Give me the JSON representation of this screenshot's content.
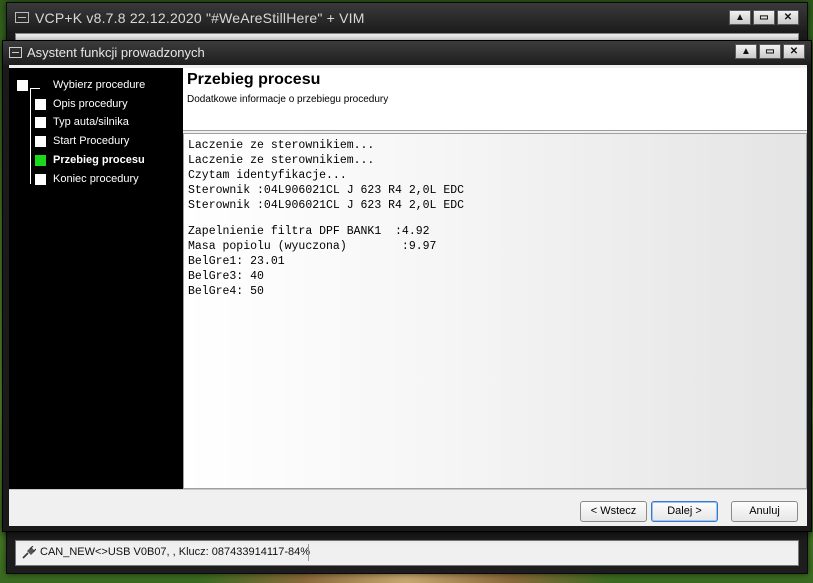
{
  "main_window": {
    "title": "VCP+K v8.7.8 22.12.2020 \"#WeAreStillHere\" + VIM",
    "controls": [
      "▲",
      "▭",
      "✕"
    ]
  },
  "dialog": {
    "title": "Asystent funkcji prowadzonych",
    "controls": [
      "▲",
      "▭",
      "✕"
    ]
  },
  "steps": [
    {
      "label": "Wybierz procedure",
      "active": false
    },
    {
      "label": "Opis procedury",
      "active": false
    },
    {
      "label": "Typ auta/silnika",
      "active": false
    },
    {
      "label": "Start Procedury",
      "active": false
    },
    {
      "label": "Przebieg procesu",
      "active": true
    },
    {
      "label": "Koniec procedury",
      "active": false
    }
  ],
  "header": {
    "title": "Przebieg procesu",
    "subtitle": "Dodatkowe informacje o przebiegu procedury"
  },
  "log_lines": [
    "Laczenie ze sterownikiem...",
    "Laczenie ze sterownikiem...",
    "Czytam identyfikacje...",
    "Sterownik :04L906021CL J 623 R4 2,0L EDC",
    "Sterownik :04L906021CL J 623 R4 2,0L EDC",
    "",
    "Zapelnienie filtra DPF BANK1  :4.92",
    "Masa popiolu (wyuczona)        :9.97",
    "BelGre1: 23.01",
    "BelGre3: 40",
    "BelGre4: 50"
  ],
  "buttons": {
    "back": "< Wstecz",
    "next": "Dalej >",
    "cancel": "Anuluj"
  },
  "status_bar": {
    "text": "CAN_NEW<>USB V0B07, , Klucz: 087433914117-84%"
  },
  "colors": {
    "active_step": "#1bd81b",
    "tree_background": "#000000",
    "default_button_border": "#3a78c8"
  }
}
